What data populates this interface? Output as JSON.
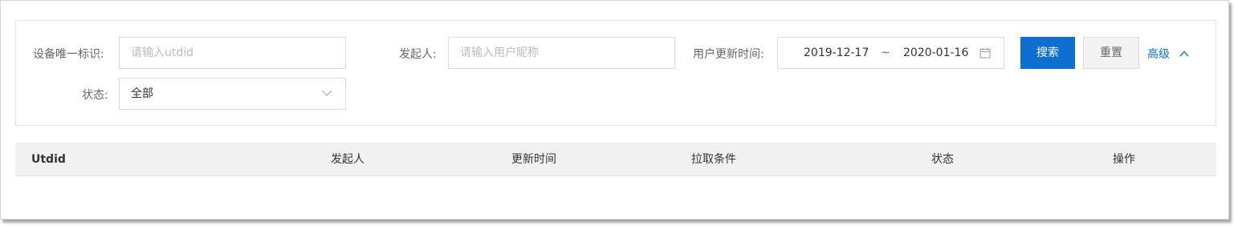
{
  "filters": {
    "utdid_label": "设备唯一标识:",
    "utdid_placeholder": "请输入utdid",
    "initiator_label": "发起人:",
    "initiator_placeholder": "请输入用户昵称",
    "update_time_label": "用户更新时间:",
    "date_start": "2019-12-17",
    "date_separator": "~",
    "date_end": "2020-01-16",
    "status_label": "状态:",
    "status_value": "全部"
  },
  "actions": {
    "search_label": "搜索",
    "reset_label": "重置",
    "advanced_label": "高级"
  },
  "table": {
    "columns": [
      "Utdid",
      "发起人",
      "更新时间",
      "拉取条件",
      "状态",
      "操作"
    ]
  },
  "colors": {
    "primary": "#0f6fd0",
    "header_bg": "#f1f1f1",
    "border": "#d9d9d9"
  },
  "icons": {
    "date": "calendar-icon",
    "status_select": "chevron-down-icon",
    "advanced": "chevron-up-icon"
  }
}
